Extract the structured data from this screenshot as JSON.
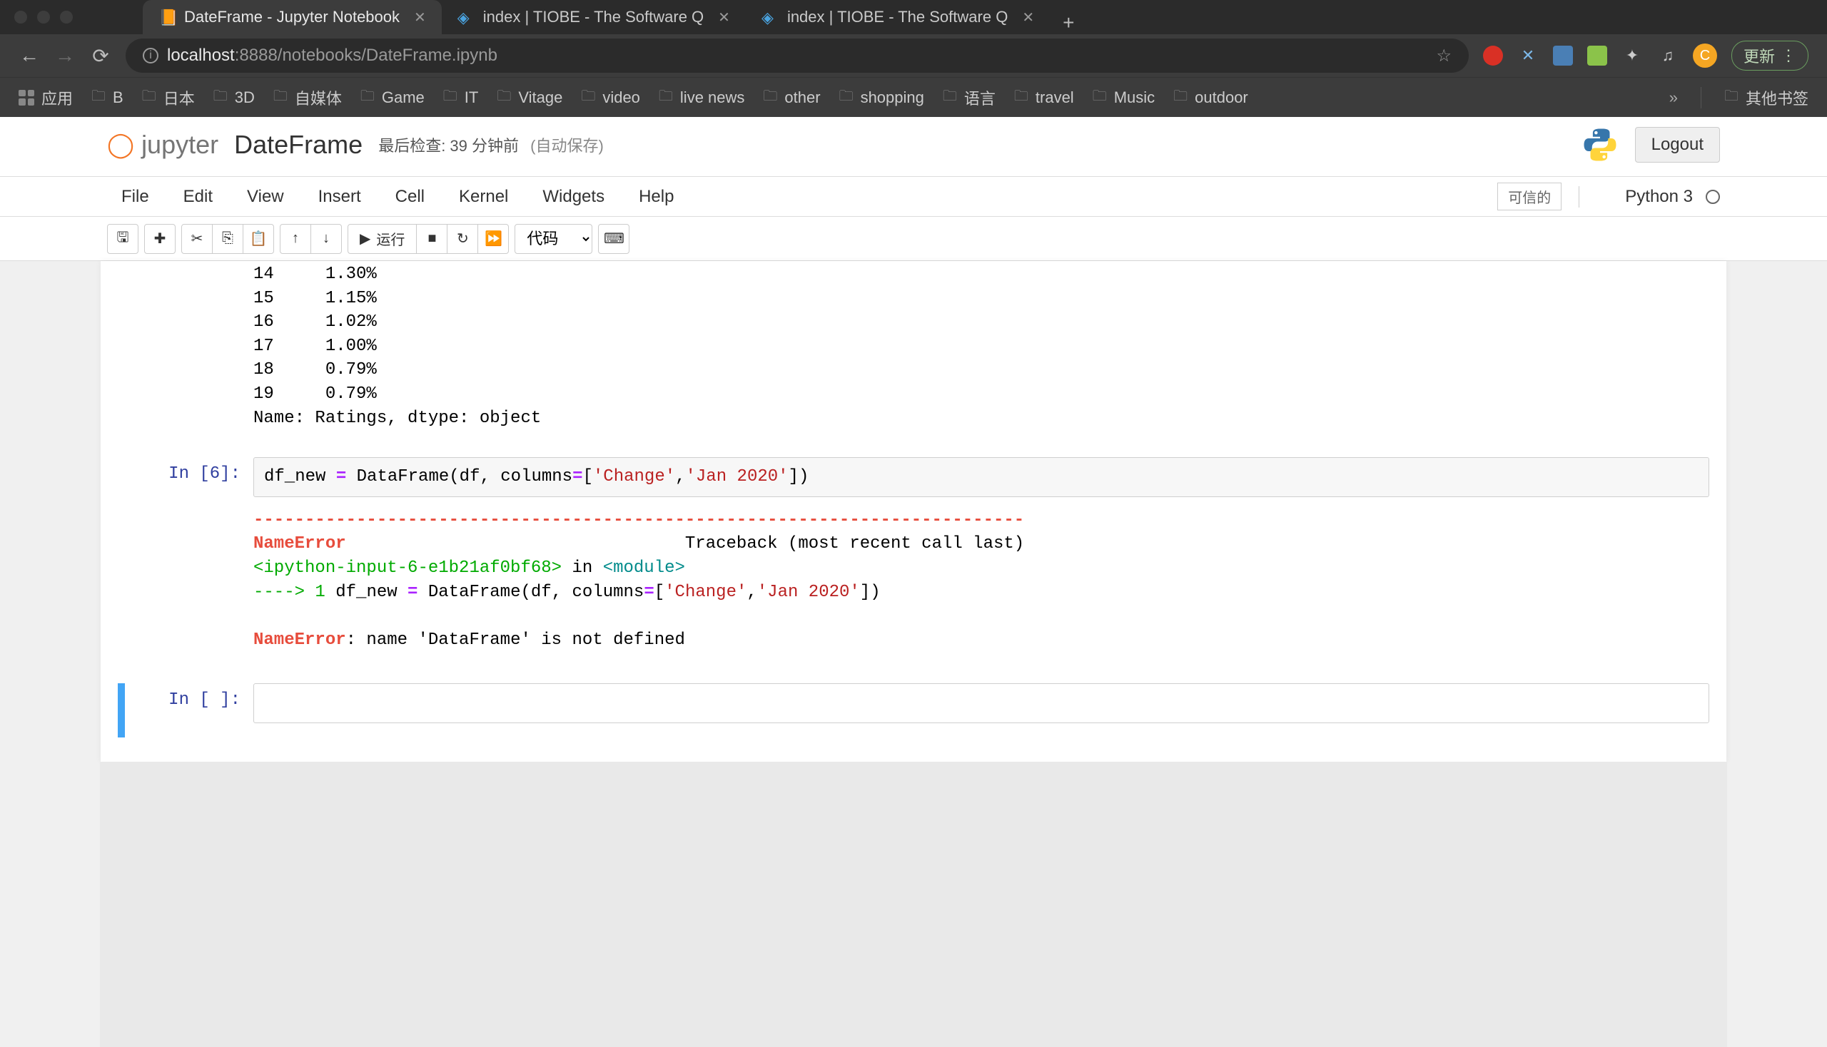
{
  "browser": {
    "tabs": [
      {
        "title": "DateFrame - Jupyter Notebook",
        "active": true
      },
      {
        "title": "index | TIOBE - The Software Q",
        "active": false
      },
      {
        "title": "index | TIOBE - The Software Q",
        "active": false
      }
    ],
    "url_domain": "localhost",
    "url_port_path": ":8888/notebooks/DateFrame.ipynb",
    "update_label": "更新",
    "avatar_initial": "C",
    "apps_label": "应用",
    "bookmarks": [
      "B",
      "日本",
      "3D",
      "自媒体",
      "Game",
      "IT",
      "Vitage",
      "video",
      "live news",
      "other",
      "shopping",
      "语言",
      "travel",
      "Music",
      "outdoor"
    ],
    "bm_overflow": "»",
    "bm_others": "其他书签"
  },
  "jupyter": {
    "logo_text": "jupyter",
    "notebook_title": "DateFrame",
    "checkpoint_text": "最后检查: 39 分钟前",
    "autosave_text": "(自动保存)",
    "logout_label": "Logout",
    "menubar": [
      "File",
      "Edit",
      "View",
      "Insert",
      "Cell",
      "Kernel",
      "Widgets",
      "Help"
    ],
    "trusted_label": "可信的",
    "kernel_name": "Python 3",
    "toolbar": {
      "run_label": "运行",
      "cell_type": "代码"
    }
  },
  "notebook": {
    "output_top_lines": [
      "14     1.30%",
      "15     1.15%",
      "16     1.02%",
      "17     1.00%",
      "18     0.79%",
      "19     0.79%",
      "Name: Ratings, dtype: object"
    ],
    "cell6": {
      "prompt": "In [6]:",
      "code_var": "df_new ",
      "code_eq": "=",
      "code_func": " DataFrame(df, columns",
      "code_eq2": "=",
      "code_bracket_open": "[",
      "code_str1": "'Change'",
      "code_comma": ",",
      "code_str2": "'Jan 2020'",
      "code_bracket_close": "])"
    },
    "error": {
      "dashes": "---------------------------------------------------------------------------",
      "name_error": "NameError",
      "traceback_spaces": "                                 ",
      "traceback": "Traceback (most recent call last)",
      "ipython_input": "<ipython-input-6-e1b21af0bf68>",
      "in_word": " in ",
      "module": "<module>",
      "arrow": "----> 1",
      "err_line_pre": " df_new ",
      "err_eq": "=",
      "err_func": " DataFrame",
      "err_paren_open": "(",
      "err_df": "df",
      "err_comma_sp": ", ",
      "err_cols": "columns",
      "err_eq2": "=",
      "err_list_open": "[",
      "err_str1": "'Change'",
      "err_comma": ",",
      "err_str2": "'Jan 2020'",
      "err_list_close": "])",
      "final_name_error": "NameError",
      "final_msg": ": name 'DataFrame' is not defined"
    },
    "empty_prompt": "In [ ]:"
  }
}
